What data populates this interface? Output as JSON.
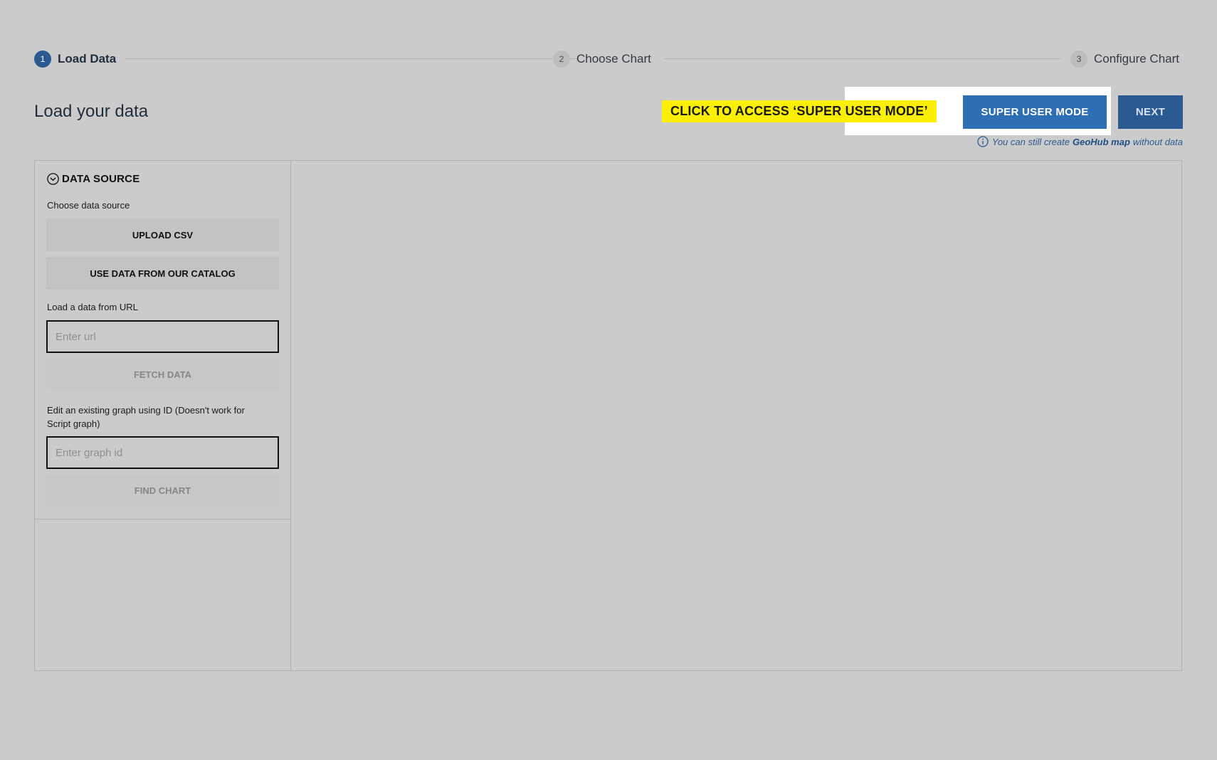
{
  "stepper": {
    "steps": [
      {
        "number": "1",
        "label": "Load Data",
        "state": "active"
      },
      {
        "number": "2",
        "label": "Choose Chart",
        "state": "inactive"
      },
      {
        "number": "3",
        "label": "Configure Chart",
        "state": "inactive"
      }
    ]
  },
  "header": {
    "title": "Load your data",
    "callout": "CLICK TO ACCESS ‘SUPER USER MODE’",
    "super_user_label": "SUPER USER MODE",
    "next_label": "NEXT",
    "info": {
      "prefix": "You can still create",
      "link": "GeoHub map",
      "suffix": "without data"
    }
  },
  "sidebar": {
    "section_title": "DATA SOURCE",
    "choose_label": "Choose data source",
    "upload_csv_label": "UPLOAD CSV",
    "catalog_label": "USE DATA FROM OUR CATALOG",
    "url_label": "Load a data from URL",
    "url_placeholder": "Enter url",
    "fetch_label": "FETCH DATA",
    "graph_label": "Edit an existing graph using ID (Doesn't work for Script graph)",
    "graph_placeholder": "Enter graph id",
    "find_label": "FIND CHART"
  },
  "colors": {
    "background": "#cbcbcb",
    "primary": "#2e6eb5",
    "primary_dark": "#2a5a92",
    "callout": "#fbef04"
  },
  "icons": {
    "section_toggle": "chevron-down-circle-icon",
    "info": "info-circle-icon"
  }
}
